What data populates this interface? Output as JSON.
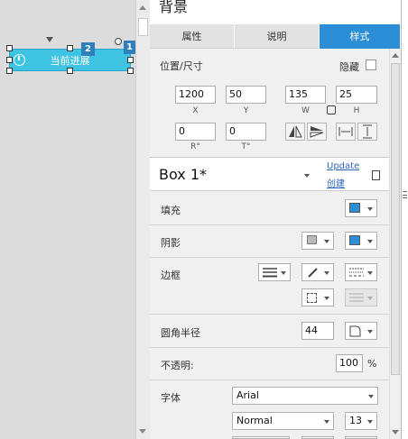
{
  "panel": {
    "title": "背景",
    "tabs": [
      {
        "label": "属性",
        "active": false
      },
      {
        "label": "说明",
        "active": false
      },
      {
        "label": "样式",
        "active": true
      }
    ]
  },
  "canvas": {
    "widget_text": "当前进展",
    "marker_2": "2",
    "marker_1": "1"
  },
  "position_size": {
    "section_label": "位置/尺寸",
    "hide_label": "隐藏",
    "hide_checked": false,
    "x": {
      "value": "1200",
      "label": "X"
    },
    "y": {
      "value": "50",
      "label": "Y"
    },
    "w": {
      "value": "135",
      "label": "W"
    },
    "h": {
      "value": "25",
      "label": "H"
    },
    "rotation": {
      "value": "0",
      "label": "R°"
    },
    "text_rotation": {
      "value": "0",
      "label": "T°"
    }
  },
  "style": {
    "name": "Box 1*",
    "update_link": "Update",
    "create_link": "创建"
  },
  "fill": {
    "label": "填充",
    "color": "#2b8ed6"
  },
  "shadow": {
    "label": "阴影",
    "color": "#2b8ed6"
  },
  "border": {
    "label": "边框"
  },
  "corner_radius": {
    "label": "圆角半径",
    "value": "44"
  },
  "opacity": {
    "label": "不透明:",
    "value": "100",
    "unit": "%"
  },
  "font": {
    "label": "字体",
    "family": "Arial",
    "weight": "Normal",
    "size": "13"
  },
  "colors": {
    "accent": "#2b8ed6",
    "widget": "#3fc3e3"
  }
}
